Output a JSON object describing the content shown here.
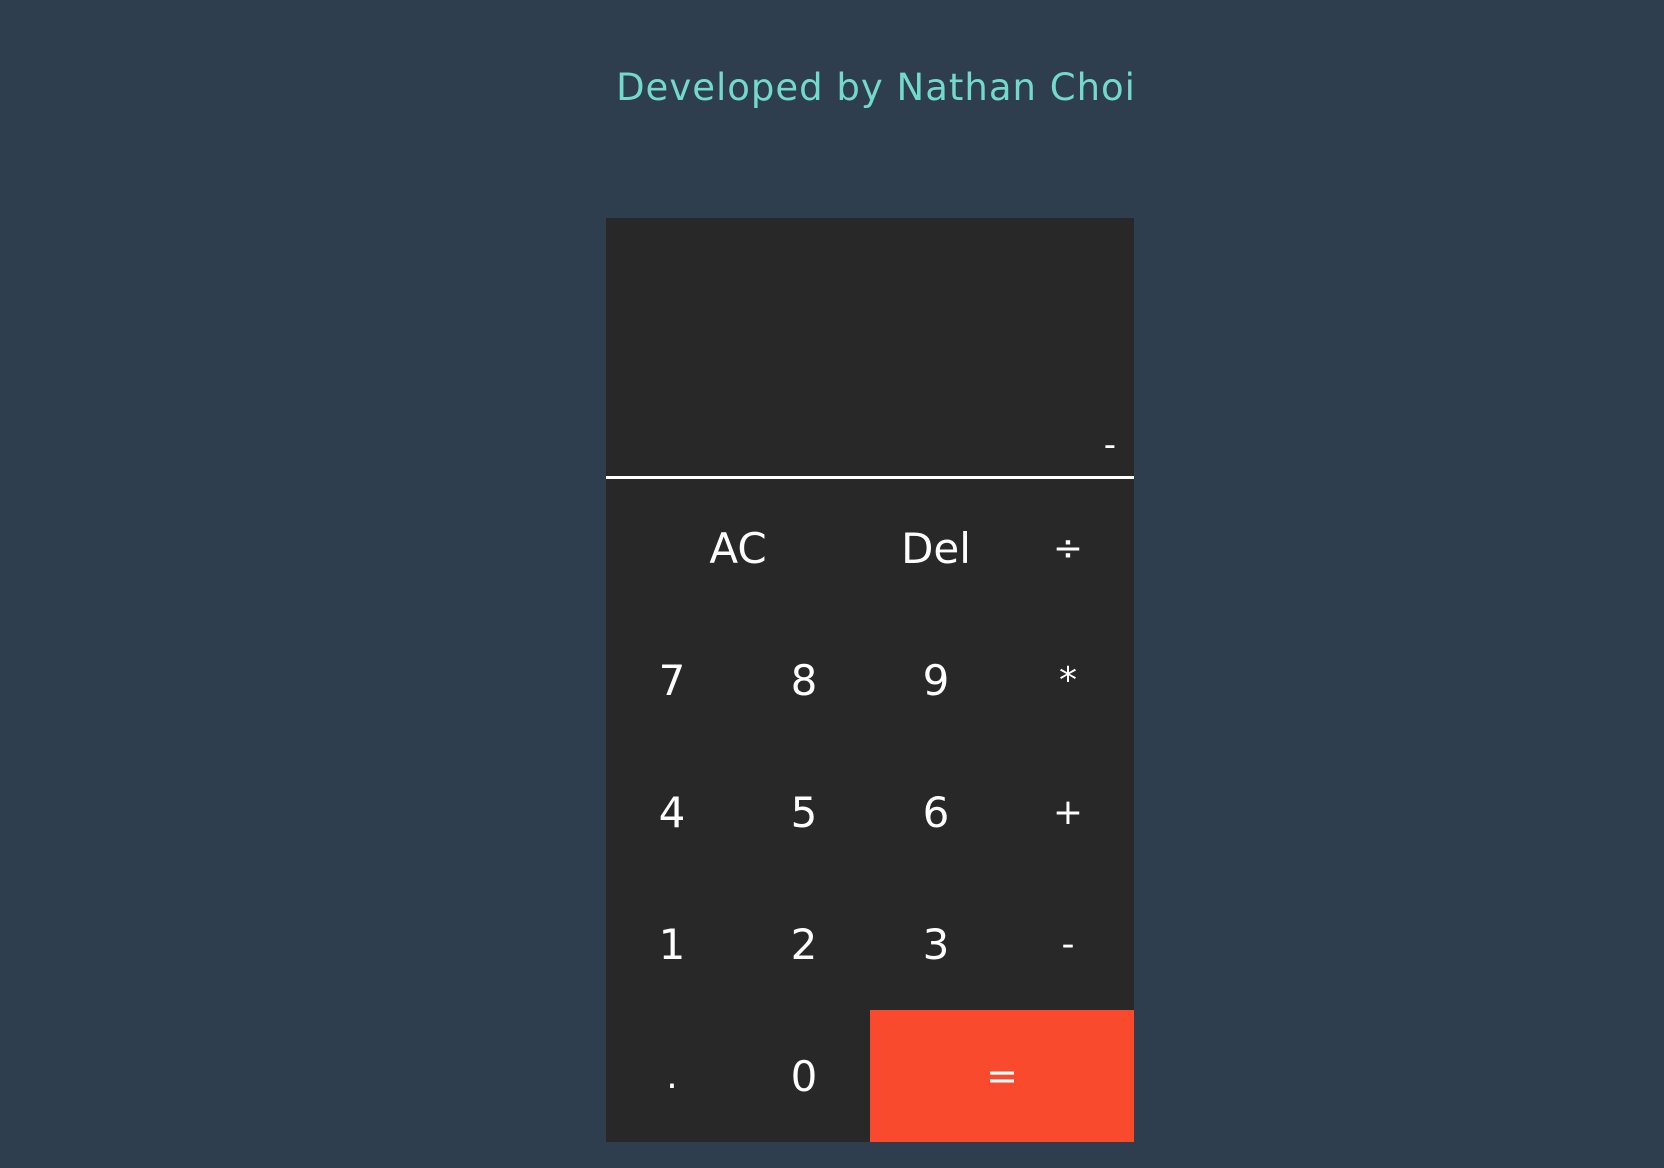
{
  "header": {
    "credit": "Developed by Nathan Choi"
  },
  "display": {
    "value": "-"
  },
  "keys": {
    "ac": "AC",
    "del": "Del",
    "divide": "÷",
    "seven": "7",
    "eight": "8",
    "nine": "9",
    "multiply": "*",
    "four": "4",
    "five": "5",
    "six": "6",
    "plus": "+",
    "one": "1",
    "two": "2",
    "three": "3",
    "minus": "-",
    "decimal": ".",
    "zero": "0",
    "equals": "="
  },
  "colors": {
    "background": "#2e3e4f",
    "calculator": "#282828",
    "credit_text": "#73d9cd",
    "equals_key": "#fa4a2e",
    "key_text": "#ffffff"
  }
}
